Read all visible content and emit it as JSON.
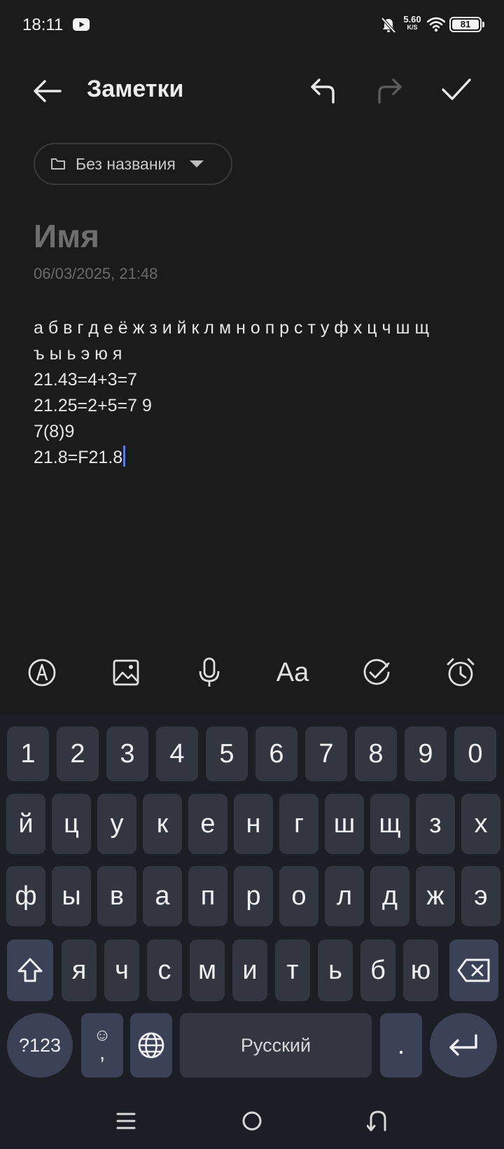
{
  "status_bar": {
    "time": "18:11",
    "net_speed_value": "5.60",
    "net_speed_unit": "K/S",
    "battery": "81"
  },
  "toolbar": {
    "title": "Заметки"
  },
  "folder": {
    "label": "Без названия"
  },
  "note": {
    "title_placeholder": "Имя",
    "date": "06/03/2025, 21:48",
    "lines": [
      "а б в г д е ё ж з и й к л м н о п р с т у ф х ц ч ш щ",
      "ъ ы ь э ю я",
      "21.43=4+3=7",
      "21.25=2+5=7 9",
      "7(8)9",
      "21.8=F21.8"
    ]
  },
  "tools": {
    "format_label": "Aa"
  },
  "keyboard": {
    "row_numbers": [
      "1",
      "2",
      "3",
      "4",
      "5",
      "6",
      "7",
      "8",
      "9",
      "0"
    ],
    "row1": [
      "й",
      "ц",
      "у",
      "к",
      "е",
      "н",
      "г",
      "ш",
      "щ",
      "з",
      "х"
    ],
    "row2": [
      "ф",
      "ы",
      "в",
      "а",
      "п",
      "р",
      "о",
      "л",
      "д",
      "ж",
      "э"
    ],
    "row3": [
      "я",
      "ч",
      "с",
      "м",
      "и",
      "т",
      "ь",
      "б",
      "ю"
    ],
    "symbols_label": "?123",
    "emoji_top": "☺",
    "comma": ",",
    "space_label": "Русский",
    "period": "."
  },
  "colors": {
    "background": "#1b1b1b",
    "keyboard_bg": "#1b1e25",
    "key_bg": "#323640",
    "key_special_bg": "#3c4255",
    "cursor": "#4f7fff"
  }
}
